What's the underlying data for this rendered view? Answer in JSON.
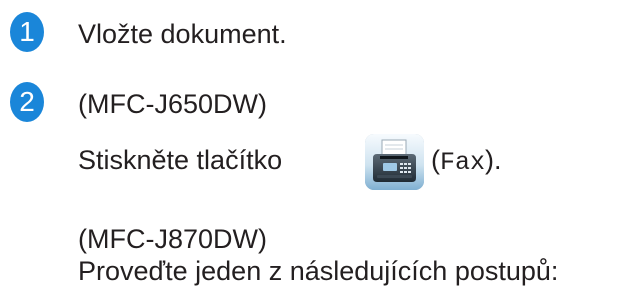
{
  "steps": [
    {
      "number": "1",
      "text": "Vložte dokument."
    },
    {
      "number": "2",
      "model_a": "(MFC-J650DW)",
      "press_prefix": "Stiskněte tlačítko",
      "button_open_paren": "(",
      "button_name": "Fax",
      "button_close": ").",
      "model_b": "(MFC-J870DW)",
      "instruction": "Proveďte jeden z následujících postupů:"
    }
  ],
  "icons": {
    "fax_button": "fax-icon"
  },
  "colors": {
    "step_badge": "#1a86d9",
    "text": "#231f20"
  }
}
